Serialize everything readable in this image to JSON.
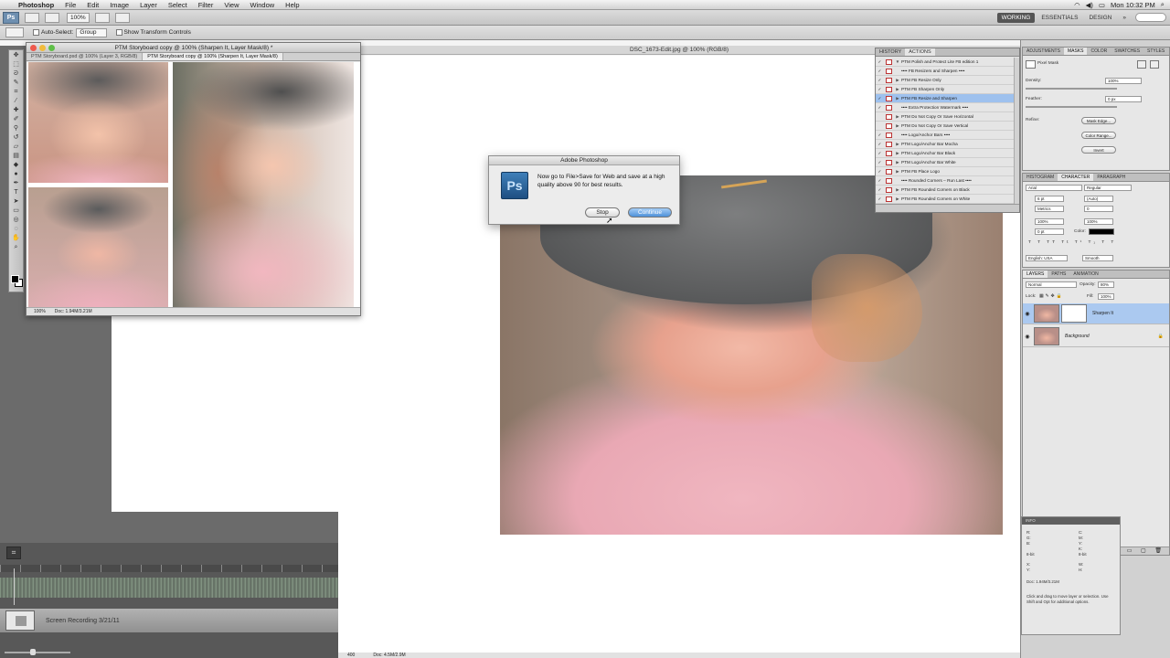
{
  "menubar": {
    "app_name": "Photoshop",
    "items": [
      "File",
      "Edit",
      "Image",
      "Layer",
      "Select",
      "Filter",
      "View",
      "Window",
      "Help"
    ],
    "clock": "Mon 10:32 PM"
  },
  "appbar": {
    "logo": "Ps",
    "zoom": "100%",
    "workspaces": [
      "WORKING",
      "ESSENTIALS",
      "DESIGN",
      "»"
    ]
  },
  "optionsbar": {
    "auto_select_label": "Auto-Select:",
    "auto_select_value": "Group",
    "transform_label": "Show Transform Controls"
  },
  "main_document": {
    "tab_title": "DSC_1673-Edit.jpg @ 100% (RGB/8)",
    "status_zoom": "400",
    "status_doc": "Doc: 4.5M/2.9M"
  },
  "storyboard_window": {
    "title": "PTM Storyboard copy @ 100% (Sharpen It, Layer Mask/8) *",
    "tabs": [
      "PTM Storyboard.psd @ 100% (Layer 3, RGB/8)",
      "PTM Storyboard copy @ 100% (Sharpen It, Layer Mask/8)"
    ],
    "status_zoom": "100%",
    "status_doc": "Doc: 1.94M/3.21M"
  },
  "dialog": {
    "title": "Adobe Photoshop",
    "icon": "Ps",
    "message": "Now go to File>Save for Web and save at a high quality above 90 for best results.",
    "stop_label": "Stop",
    "continue_label": "Continue"
  },
  "actions_panel": {
    "tabs": [
      "HISTORY",
      "ACTIONS"
    ],
    "rows": [
      {
        "check": "✓",
        "arrow": "▼",
        "label": "PTM Polish and Protect Lite FB edition 1"
      },
      {
        "check": "✓",
        "arrow": "",
        "label": "•••• FB Resizers and Sharpen ••••"
      },
      {
        "check": "✓",
        "arrow": "▶",
        "label": "PTM FB Resize Only"
      },
      {
        "check": "✓",
        "arrow": "▶",
        "label": "PTM FB Sharpen Only"
      },
      {
        "check": "✓",
        "arrow": "▶",
        "label": "PTM FB Resize and Sharpen"
      },
      {
        "check": "✓",
        "arrow": "",
        "label": "•••• Extra Protection Watermark ••••"
      },
      {
        "check": "",
        "arrow": "▶",
        "label": "PTM Do Not Copy Or Save Horizontal"
      },
      {
        "check": "",
        "arrow": "▶",
        "label": "PTM Do Not Copy Or Save Vertical"
      },
      {
        "check": "✓",
        "arrow": "",
        "label": "•••• Logo/Anchor Bars ••••"
      },
      {
        "check": "✓",
        "arrow": "▶",
        "label": "PTM Logo/Anchor Bar Mocha"
      },
      {
        "check": "✓",
        "arrow": "▶",
        "label": "PTM Logo/Anchor Bar Black"
      },
      {
        "check": "✓",
        "arrow": "▶",
        "label": "PTM Logo/Anchor Bar White"
      },
      {
        "check": "✓",
        "arrow": "▶",
        "label": "PTM FB Place Logo"
      },
      {
        "check": "✓",
        "arrow": "",
        "label": "•••• Rounded Corners – Run Last ••••"
      },
      {
        "check": "✓",
        "arrow": "▶",
        "label": "PTM FB Rounded Corners on Black"
      },
      {
        "check": "✓",
        "arrow": "▶",
        "label": "PTM FB Rounded Corners on White"
      }
    ],
    "highlight_index": 4
  },
  "adjustments_panel": {
    "tabs": [
      "ADJUSTMENTS",
      "MASKS",
      "COLOR",
      "SWATCHES",
      "STYLES"
    ],
    "mask_label": "Pixel Mask",
    "density_label": "Density:",
    "density_value": "100%",
    "feather_label": "Feather:",
    "feather_value": "0 px",
    "refine_label": "Refine:",
    "mask_edge_label": "Mask Edge...",
    "color_range_label": "Color Range...",
    "invert_label": "Invert"
  },
  "character_panel": {
    "tabs": [
      "HISTOGRAM",
      "CHARACTER",
      "PARAGRAPH"
    ],
    "font_family": "Arial",
    "font_style": "Regular",
    "size": "6 pt",
    "leading": "(Auto)",
    "kerning": "Metrics",
    "tracking": "0",
    "vscale": "100%",
    "hscale": "100%",
    "baseline": "0 pt",
    "color_label": "Color:",
    "language": "English: USA",
    "antialias": "Smooth"
  },
  "layers_panel": {
    "tabs": [
      "LAYERS",
      "PATHS",
      "ANIMATION"
    ],
    "blend_mode": "Normal",
    "opacity_label": "Opacity:",
    "opacity_value": "80%",
    "lock_label": "Lock:",
    "fill_label": "Fill:",
    "fill_value": "100%",
    "layers": [
      {
        "name": "Sharpen It",
        "selected": true,
        "has_mask": true
      },
      {
        "name": "Background",
        "selected": false,
        "has_mask": false
      }
    ]
  },
  "info_panel": {
    "title": "INFO",
    "r_label": "R:",
    "g_label": "G:",
    "b_label": "B:",
    "c_label": "C:",
    "m_label": "M:",
    "y_label": "Y:",
    "k_label": "K:",
    "bit_left": "8-bit",
    "bit_right": "8-bit",
    "x_label": "X:",
    "y2_label": "Y:",
    "w_label": "W:",
    "h_label": "H:",
    "doc": "Doc: 1.94M/3.21M",
    "hint": "Click and drag to move layer or selection. Use Shift and Opt for additional options."
  },
  "recording": {
    "clip_label": "Screen Recording 3/21/11"
  }
}
